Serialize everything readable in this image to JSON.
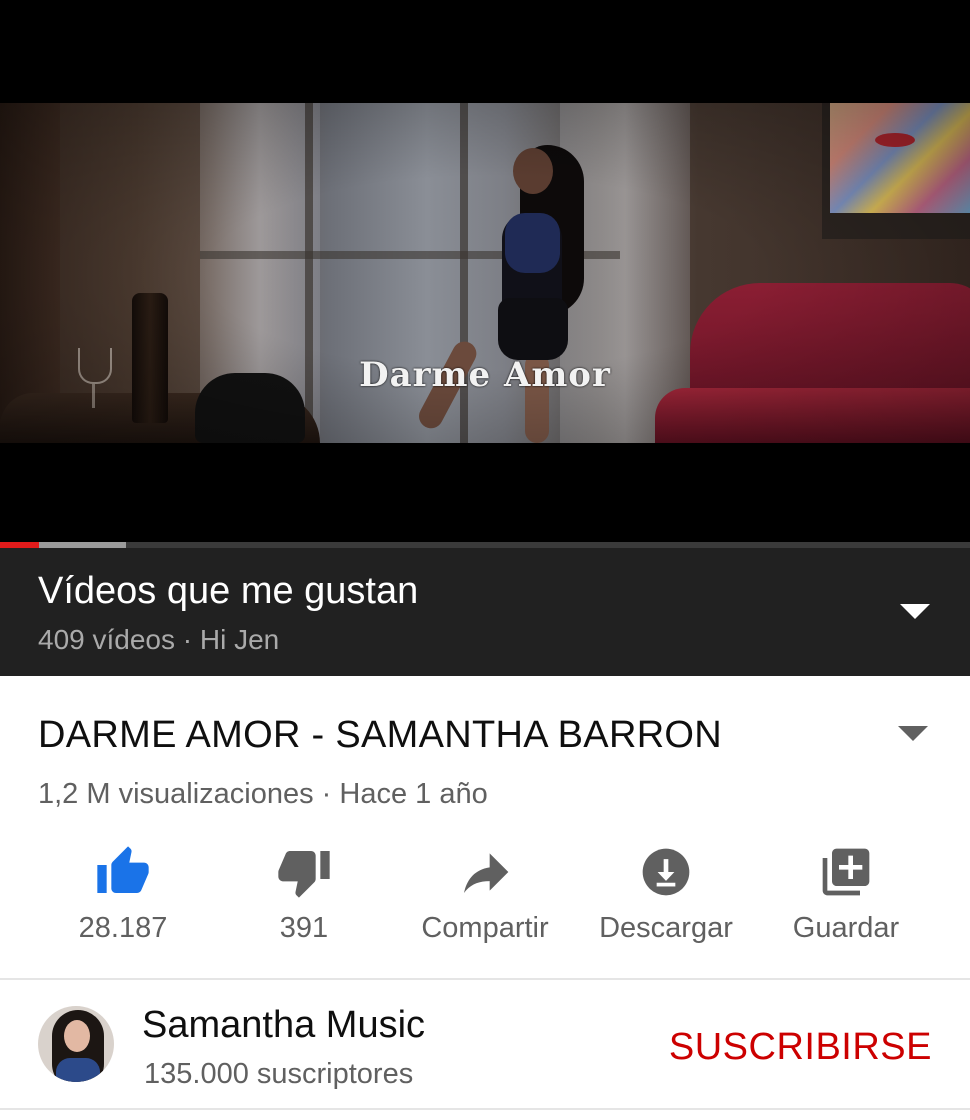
{
  "player": {
    "overlay_title": "Darme Amor",
    "progress_played": 0.04,
    "progress_buffered": 0.13,
    "colors": {
      "played": "#e21b1b",
      "buffer": "#9b9b9b"
    }
  },
  "playlist": {
    "title": "Vídeos que me gustan",
    "meta": "409 vídeos · Hi Jen",
    "expand_icon": "caret-down-icon"
  },
  "video": {
    "title": "DARME AMOR - SAMANTHA BARRON",
    "meta": "1,2 M visualizaciones · Hace 1 año",
    "expand_icon": "caret-down-icon"
  },
  "actions": [
    {
      "icon": "thumbs-up-icon",
      "label": "28.187",
      "active": true,
      "color": "#1a73e8"
    },
    {
      "icon": "thumbs-down-icon",
      "label": "391",
      "active": false,
      "color": "#606060"
    },
    {
      "icon": "share-icon",
      "label": "Compartir",
      "active": false,
      "color": "#606060"
    },
    {
      "icon": "download-icon",
      "label": "Descargar",
      "active": false,
      "color": "#606060"
    },
    {
      "icon": "save-to-playlist-icon",
      "label": "Guardar",
      "active": false,
      "color": "#606060"
    }
  ],
  "channel": {
    "name": "Samantha Music",
    "subscribers": "135.000 suscriptores",
    "subscribe_label": "SUSCRIBIRSE",
    "subscribe_color": "#cc0000"
  }
}
